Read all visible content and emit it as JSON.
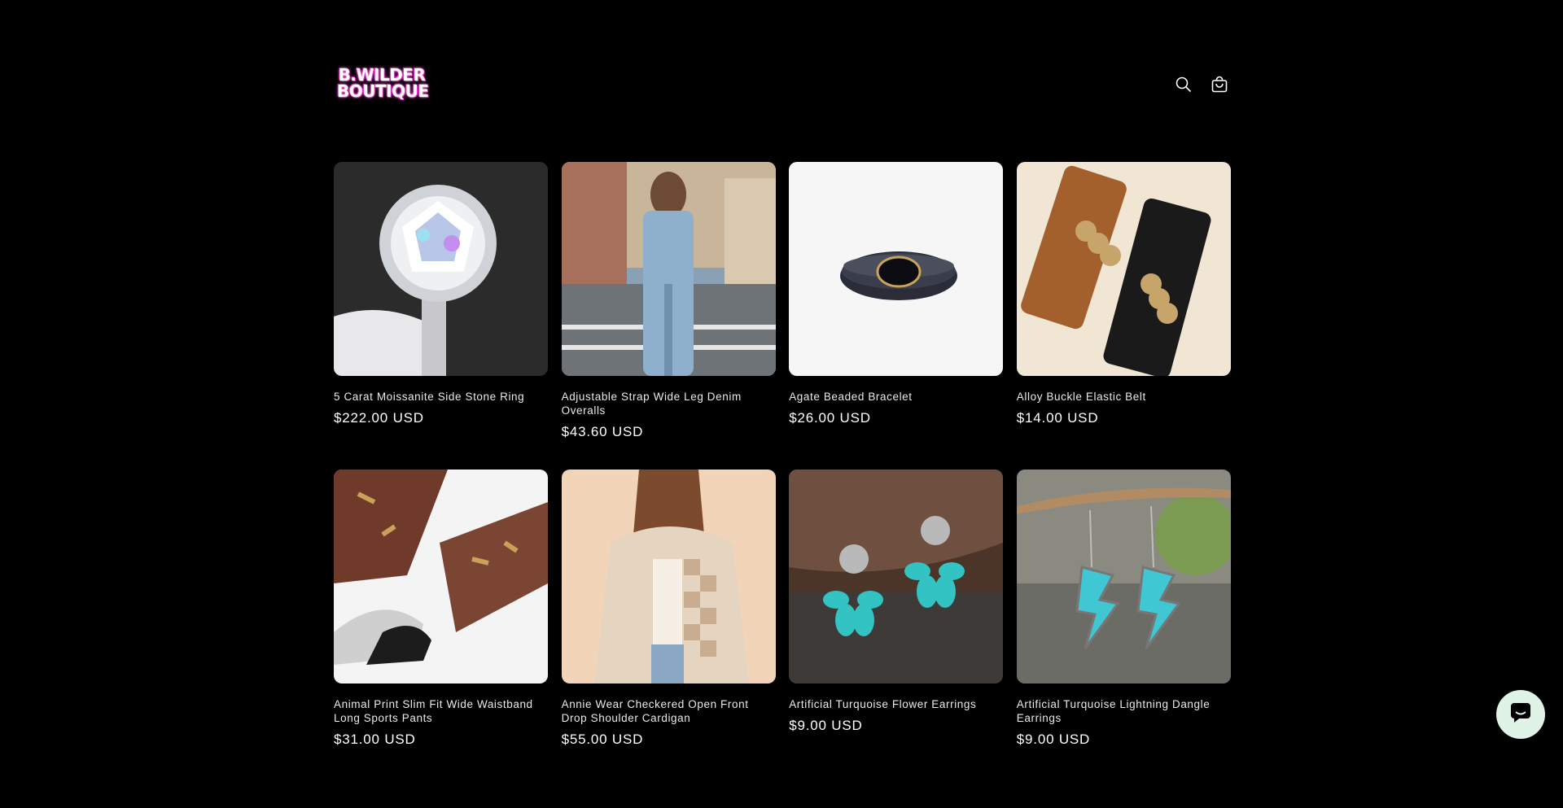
{
  "header": {
    "logo_line1": "B.WILDER",
    "logo_line2": "BOUTIQUE",
    "search_icon": "search-icon",
    "cart_icon": "cart-icon"
  },
  "products": [
    {
      "title": "5 Carat Moissanite Side Stone Ring",
      "price": "$222.00 USD"
    },
    {
      "title": "Adjustable Strap Wide Leg Denim Overalls",
      "price": "$43.60 USD"
    },
    {
      "title": "Agate Beaded Bracelet",
      "price": "$26.00 USD"
    },
    {
      "title": "Alloy Buckle Elastic Belt",
      "price": "$14.00 USD"
    },
    {
      "title": "Animal Print Slim Fit Wide Waistband Long Sports Pants",
      "price": "$31.00 USD"
    },
    {
      "title": "Annie Wear Checkered Open Front Drop Shoulder Cardigan",
      "price": "$55.00 USD"
    },
    {
      "title": "Artificial Turquoise Flower Earrings",
      "price": "$9.00 USD"
    },
    {
      "title": "Artificial Turquoise Lightning Dangle Earrings",
      "price": "$9.00 USD"
    }
  ],
  "chat": {
    "icon": "chat-icon",
    "color": "#dff3e7"
  },
  "colors": {
    "background": "#000000",
    "text": "#ffffff",
    "logo_glow": "#ff4fd8"
  }
}
